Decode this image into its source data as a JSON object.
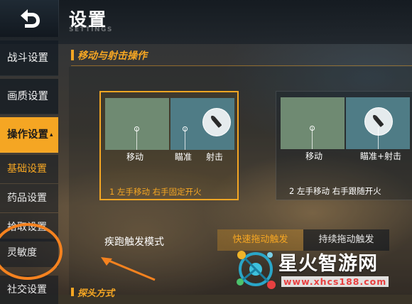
{
  "header": {
    "title": "设置",
    "subtitle": "SETTINGS"
  },
  "sidebar": {
    "items": [
      {
        "label": "战斗设置"
      },
      {
        "label": "画质设置"
      },
      {
        "label": "操作设置",
        "caret": "▴"
      }
    ],
    "subitems": [
      {
        "label": "基础设置"
      },
      {
        "label": "药品设置"
      },
      {
        "label": "拾取设置"
      },
      {
        "label": "灵敏度"
      },
      {
        "label": "社交设置"
      }
    ]
  },
  "section": {
    "title": "移动与射击操作"
  },
  "schemes": [
    {
      "labels": [
        "移动",
        "瞄准",
        "射击"
      ],
      "name": "1 左手移动 右手固定开火",
      "selected": true
    },
    {
      "labels": [
        "移动",
        "瞄准+射击"
      ],
      "name": "2 左手移动 右手跟随开火",
      "selected": false
    }
  ],
  "sprint": {
    "label": "疾跑触发模式",
    "options": [
      "快速拖动触发",
      "持续拖动触发"
    ],
    "selected": "快速拖动触发"
  },
  "section2": {
    "title": "探头方式"
  },
  "watermark": {
    "name": "星火智游网",
    "url": "www.xhcs188.com"
  },
  "colors": {
    "accent": "#f5a623",
    "annotation": "#f5821f"
  }
}
